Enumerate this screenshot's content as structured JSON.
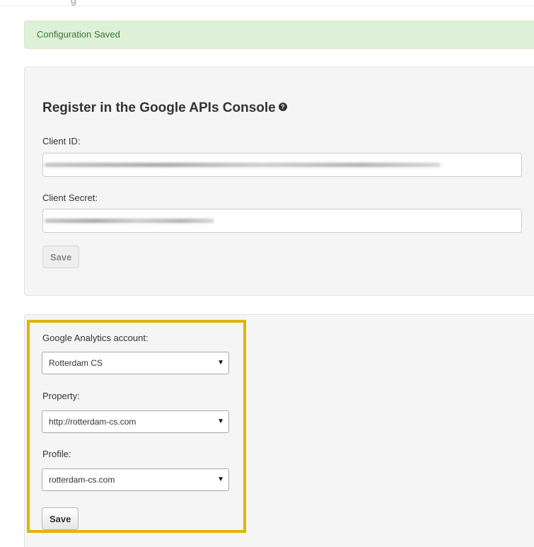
{
  "alert": {
    "message": "Configuration Saved"
  },
  "api_panel": {
    "heading": "Register in the Google APIs Console",
    "help_icon": "question-circle-icon",
    "client_id": {
      "label": "Client ID:",
      "value": ""
    },
    "client_secret": {
      "label": "Client Secret:",
      "value": ""
    },
    "save_label": "Save"
  },
  "analytics_panel": {
    "account": {
      "label": "Google Analytics account:",
      "selected": "Rotterdam CS"
    },
    "property": {
      "label": "Property:",
      "selected": "http://rotterdam-cs.com"
    },
    "profile": {
      "label": "Profile:",
      "selected": "rotterdam-cs.com"
    },
    "save_label": "Save",
    "highlight_color": "#e0b400"
  },
  "colors": {
    "alert_background": "#dff0d8",
    "alert_text": "#3c763d",
    "panel_background": "#f5f5f5"
  }
}
